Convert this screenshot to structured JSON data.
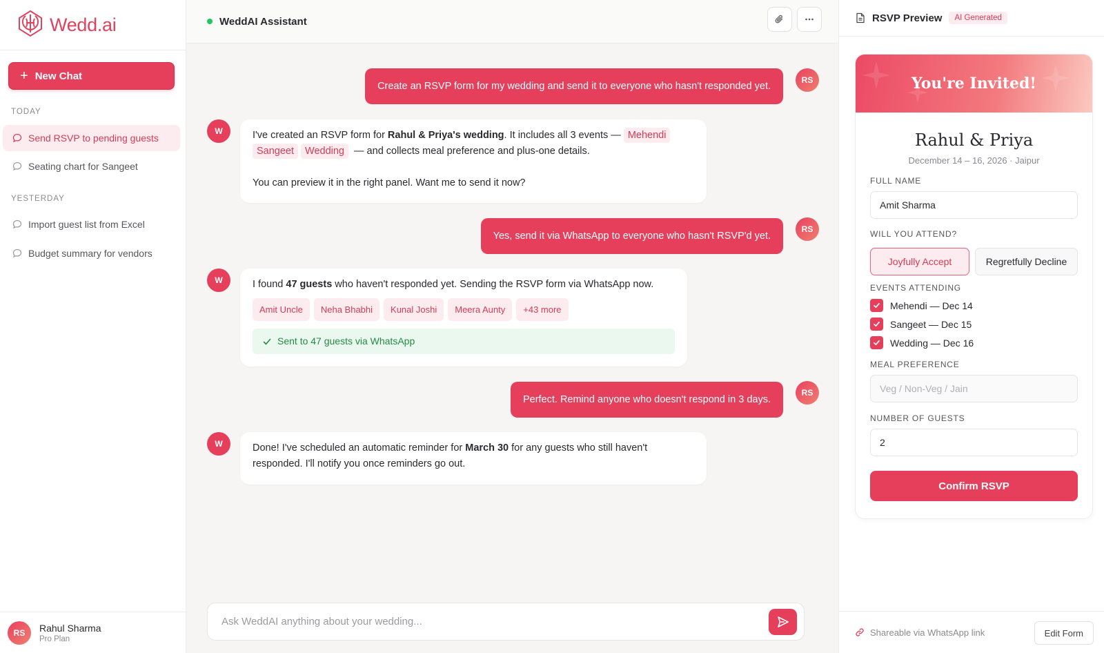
{
  "brand": {
    "name": "Wedd.ai",
    "accent": "#e63f5c"
  },
  "sidebar": {
    "new_chat_label": "New Chat",
    "today_label": "TODAY",
    "yesterday_label": "YESTERDAY",
    "today_items": [
      {
        "label": "Send RSVP to pending guests",
        "active": true
      },
      {
        "label": "Seating chart for Sangeet",
        "active": false
      }
    ],
    "yesterday_items": [
      {
        "label": "Import guest list from Excel"
      },
      {
        "label": "Budget summary for vendors"
      }
    ],
    "user": {
      "initials": "RS",
      "name": "Rahul Sharma",
      "plan": "Pro Plan"
    }
  },
  "chat": {
    "assistant_name": "WeddAI Assistant",
    "status_color": "#22c55e",
    "user_initials": "RS",
    "bot_initials": "W",
    "messages": [
      {
        "role": "user",
        "text": "Create an RSVP form for my wedding and send it to everyone who hasn't responded yet."
      },
      {
        "role": "bot",
        "part1": "I've created an RSVP form for ",
        "bold1": "Rahul & Priya's wedding",
        "part2": ". It includes all 3 events — ",
        "events": [
          "Mehendi",
          "Sangeet",
          "Wedding"
        ],
        "part3": "— and collects meal preference and plus-one details.",
        "part4": "You can preview it in the right panel. Want me to send it now?"
      },
      {
        "role": "user",
        "text": "Yes, send it via WhatsApp to everyone who hasn't RSVP'd yet."
      },
      {
        "role": "bot",
        "part1": "I found ",
        "bold1": "47 guests",
        "part2": " who haven't responded yet. Sending the RSVP form via WhatsApp now.",
        "guests": [
          "Amit Uncle",
          "Neha Bhabhi",
          "Kunal Joshi",
          "Meera Aunty",
          "+43 more"
        ],
        "sent_label": "Sent to 47 guests via WhatsApp"
      },
      {
        "role": "user",
        "text": "Perfect. Remind anyone who doesn't respond in 3 days."
      },
      {
        "role": "bot",
        "part1": "Done! I've scheduled an automatic reminder for ",
        "bold1": "March 30",
        "part2": " for any guests who still haven't responded. I'll notify you once reminders go out."
      }
    ],
    "input_placeholder": "Ask WeddAI anything about your wedding..."
  },
  "panel": {
    "title": "RSVP Preview",
    "badge": "AI Generated",
    "invited": "You're Invited!",
    "couple": "Rahul & Priya",
    "date": "December 14 – 16, 2026 · Jaipur",
    "full_name_label": "FULL NAME",
    "full_name_value": "Amit Sharma",
    "attend_label": "WILL YOU ATTEND?",
    "accept_label": "Joyfully Accept",
    "decline_label": "Regretfully Decline",
    "events_label": "EVENTS ATTENDING",
    "events": [
      "Mehendi — Dec 14",
      "Sangeet — Dec 15",
      "Wedding — Dec 16"
    ],
    "meal_label": "MEAL PREFERENCE",
    "meal_placeholder": "Veg / Non-Veg / Jain",
    "guests_label": "NUMBER OF GUESTS",
    "guests_value": "2",
    "confirm_label": "Confirm RSVP",
    "share_label": "Shareable via WhatsApp link",
    "edit_label": "Edit Form"
  }
}
